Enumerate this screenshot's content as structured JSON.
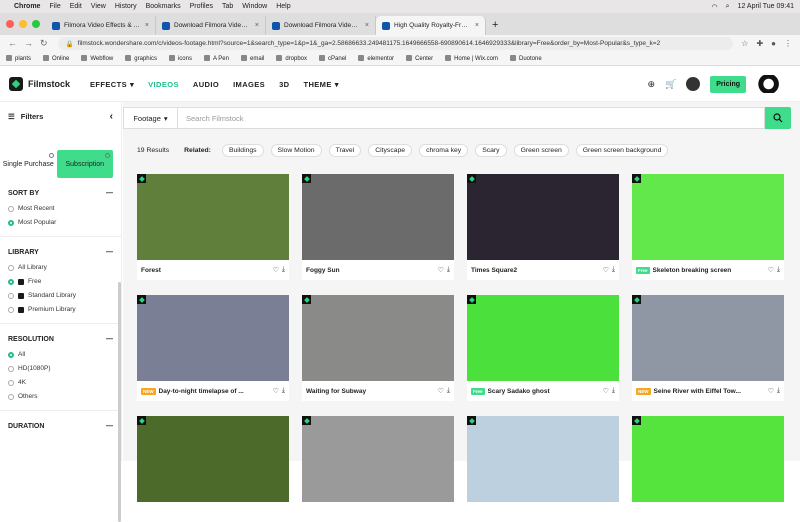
{
  "mac_menubar": {
    "app": "Chrome",
    "menus": [
      "File",
      "Edit",
      "View",
      "History",
      "Bookmarks",
      "Profiles",
      "Tab",
      "Window",
      "Help"
    ],
    "datetime": "12 April Tue 09:41"
  },
  "tabs": [
    {
      "title": "Filmora Video Effects & AE Tem",
      "active": false
    },
    {
      "title": "Download Filmora Video Effects",
      "active": false
    },
    {
      "title": "Download Filmora Video Effects",
      "active": false
    },
    {
      "title": "High Quality Royalty-Free Sto",
      "active": true
    }
  ],
  "address": {
    "url": "filmstock.wondershare.com/c/videos-footage.html?source=1&search_type=1&p=1&_ga=2.58686633.249481175.1649666558-690890614.1646929333&library=Free&order_by=Most-Popular&s_type_k=2"
  },
  "bookmarks": [
    "plants",
    "Online",
    "Webflow",
    "graphics",
    "icons",
    "A Pen",
    "email",
    "dropbox",
    "cPanel",
    "elementor",
    "Center",
    "Home | Wix.com",
    "Duotone"
  ],
  "site": {
    "brand": "Filmstock",
    "nav": [
      {
        "label": "EFFECTS",
        "caret": "▾",
        "active": false
      },
      {
        "label": "VIDEOS",
        "caret": "",
        "active": true
      },
      {
        "label": "AUDIO",
        "caret": "",
        "active": false
      },
      {
        "label": "IMAGES",
        "caret": "",
        "active": false
      },
      {
        "label": "3D",
        "caret": "",
        "active": false
      },
      {
        "label": "THEME",
        "caret": "▾",
        "active": false
      }
    ],
    "pricing": "Pricing"
  },
  "sidebar": {
    "title": "Filters",
    "purchase": {
      "single": "Single Purchase",
      "subscription": "Subscription"
    },
    "sort_by": {
      "title": "SORT BY",
      "options": [
        {
          "label": "Most Recent",
          "selected": false
        },
        {
          "label": "Most Popular",
          "selected": true
        }
      ]
    },
    "library": {
      "title": "LIBRARY",
      "options": [
        {
          "label": "All Library",
          "selected": false
        },
        {
          "label": "Free",
          "selected": true
        },
        {
          "label": "Standard Library",
          "selected": false
        },
        {
          "label": "Premium Library",
          "selected": false
        }
      ]
    },
    "resolution": {
      "title": "RESOLUTION",
      "options": [
        {
          "label": "All",
          "selected": true
        },
        {
          "label": "HD(1080P)",
          "selected": false
        },
        {
          "label": "4K",
          "selected": false
        },
        {
          "label": "Others",
          "selected": false
        }
      ]
    },
    "duration": {
      "title": "DURATION"
    }
  },
  "search": {
    "category": "Footage",
    "placeholder": "Search Filmstock"
  },
  "results": {
    "count": "19 Results",
    "related_label": "Related:",
    "tags": [
      "Buildings",
      "Slow Motion",
      "Travel",
      "Cityscape",
      "chroma key",
      "Scary",
      "Green screen",
      "Green screen background"
    ]
  },
  "cards": [
    {
      "title": "Forest",
      "label": "",
      "bg": "#5f7f3a"
    },
    {
      "title": "Foggy Sun",
      "label": "",
      "bg": "#6b6b6b"
    },
    {
      "title": "Times Square2",
      "label": "",
      "bg": "#2a2530"
    },
    {
      "title": "Skeleton breaking screen",
      "label": "Free",
      "bg": "#62e84a"
    },
    {
      "title": "Day-to-night timelapse of ...",
      "label": "NEW",
      "bg": "#7a7f95"
    },
    {
      "title": "Waiting for Subway",
      "label": "",
      "bg": "#8a8a88"
    },
    {
      "title": "Scary Sadako ghost",
      "label": "Free",
      "bg": "#4be03c"
    },
    {
      "title": "Seine River with Eiffel Tow...",
      "label": "NEW",
      "bg": "#8e97a3"
    },
    {
      "title": "",
      "label": "",
      "bg": "#4c6a2a"
    },
    {
      "title": "",
      "label": "",
      "bg": "#9a9a9a"
    },
    {
      "title": "",
      "label": "",
      "bg": "#bcd0e0"
    },
    {
      "title": "",
      "label": "",
      "bg": "#55e33e"
    }
  ]
}
